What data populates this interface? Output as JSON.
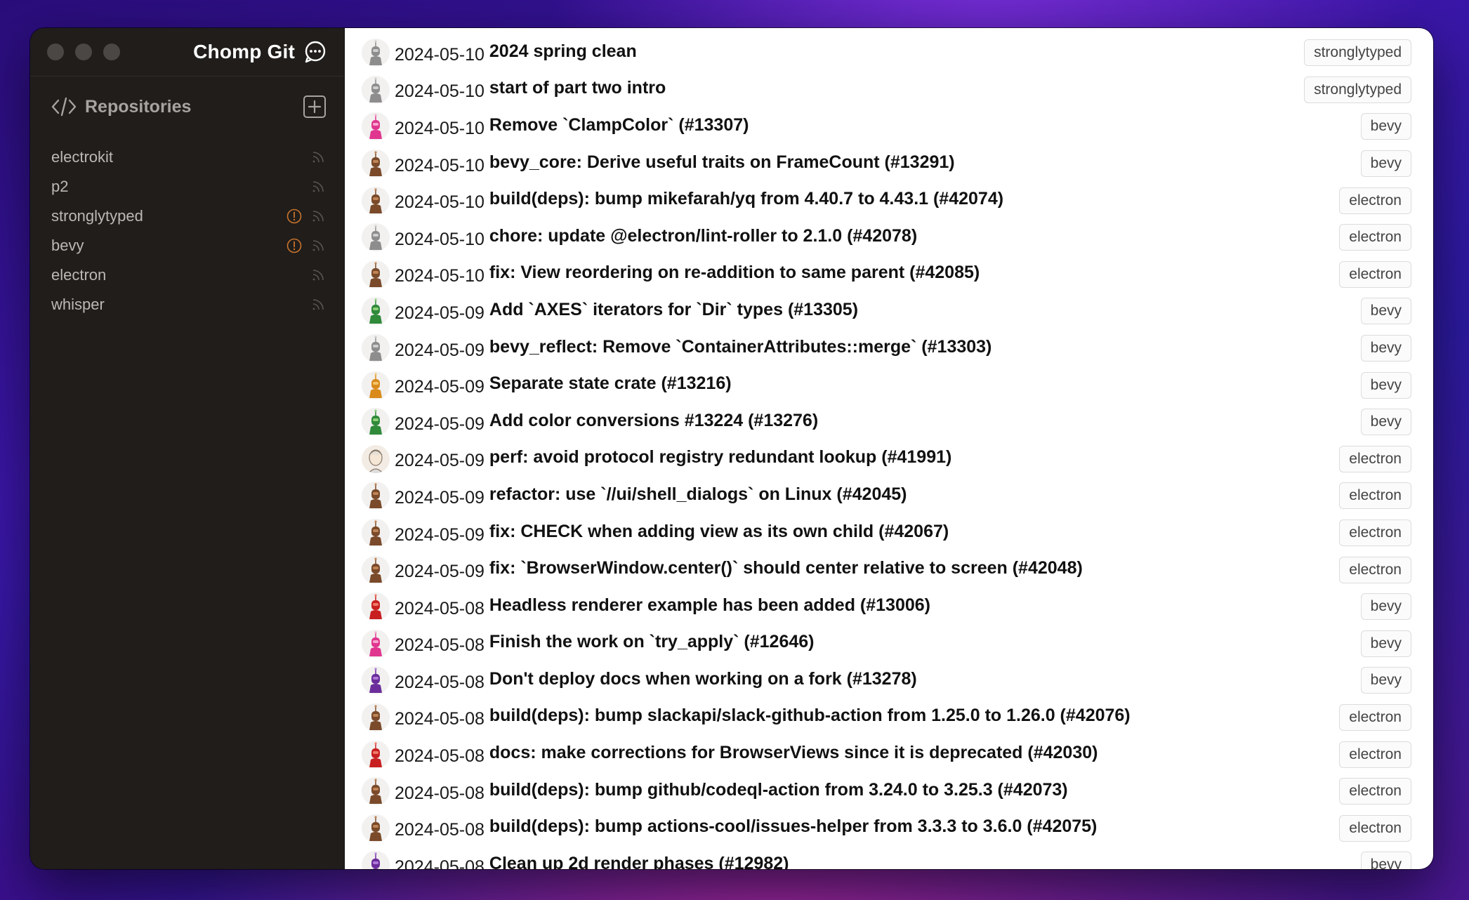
{
  "app": {
    "title": "Chomp Git"
  },
  "sidebar": {
    "section_title": "Repositories",
    "repositories": [
      {
        "name": "electrokit",
        "warning": false
      },
      {
        "name": "p2",
        "warning": false
      },
      {
        "name": "stronglytyped",
        "warning": true
      },
      {
        "name": "bevy",
        "warning": true
      },
      {
        "name": "electron",
        "warning": false
      },
      {
        "name": "whisper",
        "warning": false
      }
    ]
  },
  "colors": {
    "warning": "#c9742b",
    "sidebar_bg": "#201d1b",
    "main_bg": "#ffffff"
  },
  "commits": [
    {
      "date": "2024-05-10",
      "message": "2024 spring clean",
      "repo": "stronglytyped",
      "avatar": "robot-grey-icon"
    },
    {
      "date": "2024-05-10",
      "message": "start of part two intro",
      "repo": "stronglytyped",
      "avatar": "robot-grey-icon"
    },
    {
      "date": "2024-05-10",
      "message": "Remove `ClampColor` (#13307)",
      "repo": "bevy",
      "avatar": "robot-pink-icon"
    },
    {
      "date": "2024-05-10",
      "message": "bevy_core: Derive useful traits on FrameCount (#13291)",
      "repo": "bevy",
      "avatar": "robot-brown-icon"
    },
    {
      "date": "2024-05-10",
      "message": "build(deps): bump mikefarah/yq from 4.40.7 to 4.43.1 (#42074)",
      "repo": "electron",
      "avatar": "robot-brown-icon"
    },
    {
      "date": "2024-05-10",
      "message": "chore: update @electron/lint-roller to 2.1.0 (#42078)",
      "repo": "electron",
      "avatar": "robot-grey-icon"
    },
    {
      "date": "2024-05-10",
      "message": "fix: View reordering on re-addition to same parent (#42085)",
      "repo": "electron",
      "avatar": "robot-brown-icon"
    },
    {
      "date": "2024-05-09",
      "message": "Add `AXES` iterators for `Dir` types (#13305)",
      "repo": "bevy",
      "avatar": "robot-green-icon"
    },
    {
      "date": "2024-05-09",
      "message": "bevy_reflect: Remove `ContainerAttributes::merge` (#13303)",
      "repo": "bevy",
      "avatar": "robot-grey-icon"
    },
    {
      "date": "2024-05-09",
      "message": "Separate state crate (#13216)",
      "repo": "bevy",
      "avatar": "robot-orange-icon"
    },
    {
      "date": "2024-05-09",
      "message": "Add color conversions #13224 (#13276)",
      "repo": "bevy",
      "avatar": "robot-green-icon"
    },
    {
      "date": "2024-05-09",
      "message": "perf: avoid protocol registry redundant lookup (#41991)",
      "repo": "electron",
      "avatar": "portrait-icon"
    },
    {
      "date": "2024-05-09",
      "message": "refactor: use `//ui/shell_dialogs` on Linux (#42045)",
      "repo": "electron",
      "avatar": "robot-brown-icon"
    },
    {
      "date": "2024-05-09",
      "message": "fix: CHECK when adding view as its own child (#42067)",
      "repo": "electron",
      "avatar": "robot-brown-icon"
    },
    {
      "date": "2024-05-09",
      "message": "fix: `BrowserWindow.center()` should center relative to screen (#42048)",
      "repo": "electron",
      "avatar": "robot-brown-icon"
    },
    {
      "date": "2024-05-08",
      "message": "Headless renderer example has been added (#13006)",
      "repo": "bevy",
      "avatar": "robot-red-icon"
    },
    {
      "date": "2024-05-08",
      "message": "Finish the work on `try_apply` (#12646)",
      "repo": "bevy",
      "avatar": "robot-pink-icon"
    },
    {
      "date": "2024-05-08",
      "message": "Don't deploy docs when working on a fork (#13278)",
      "repo": "bevy",
      "avatar": "robot-purple-icon"
    },
    {
      "date": "2024-05-08",
      "message": "build(deps): bump slackapi/slack-github-action from 1.25.0 to 1.26.0 (#42076)",
      "repo": "electron",
      "avatar": "robot-brown-icon"
    },
    {
      "date": "2024-05-08",
      "message": "docs: make corrections for BrowserViews since it is deprecated (#42030)",
      "repo": "electron",
      "avatar": "robot-red-icon"
    },
    {
      "date": "2024-05-08",
      "message": "build(deps): bump github/codeql-action from 3.24.0 to 3.25.3 (#42073)",
      "repo": "electron",
      "avatar": "robot-brown-icon"
    },
    {
      "date": "2024-05-08",
      "message": "build(deps): bump actions-cool/issues-helper from 3.3.3 to 3.6.0 (#42075)",
      "repo": "electron",
      "avatar": "robot-brown-icon"
    },
    {
      "date": "2024-05-08",
      "message": "Clean up 2d render phases (#12982)",
      "repo": "bevy",
      "avatar": "robot-purple-icon"
    }
  ]
}
